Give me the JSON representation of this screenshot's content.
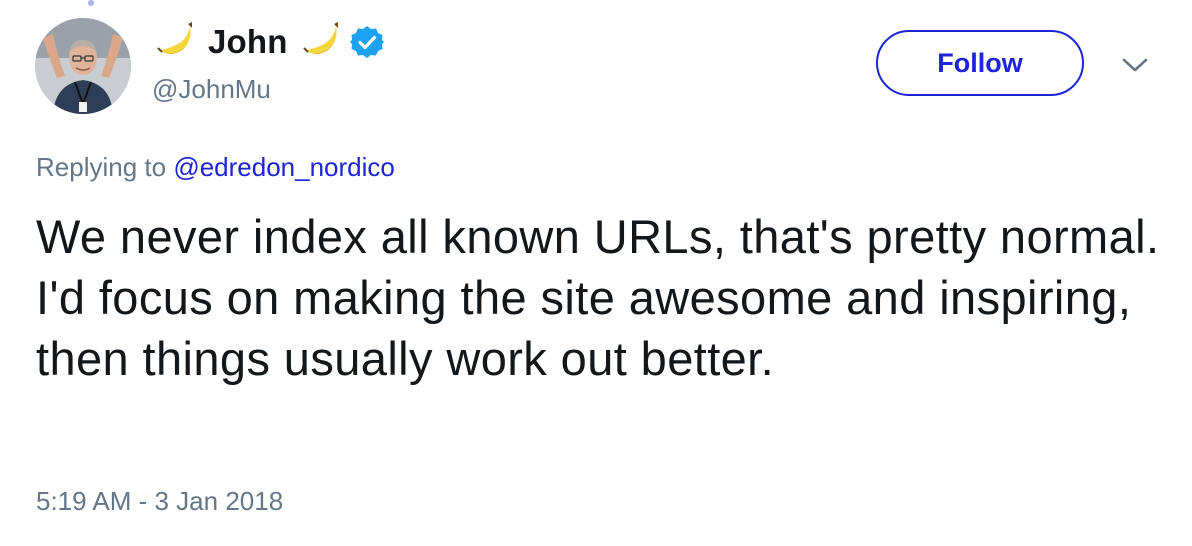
{
  "user": {
    "name": "John",
    "handle": "@JohnMu",
    "verified": true,
    "name_emoji": "banana-emoji"
  },
  "follow_button": {
    "label": "Follow"
  },
  "reply": {
    "prefix": "Replying to",
    "to_handle": "@edredon_nordico"
  },
  "tweet": {
    "text": "We never index all known URLs, that's pretty normal. I'd focus on making the site awesome and inspiring, then things usually work out better."
  },
  "timestamp": "5:19 AM - 3 Jan 2018",
  "colors": {
    "link": "#1d24d8",
    "verified": "#1da1f2",
    "secondary_text": "#657786",
    "primary_text": "#14171a"
  }
}
